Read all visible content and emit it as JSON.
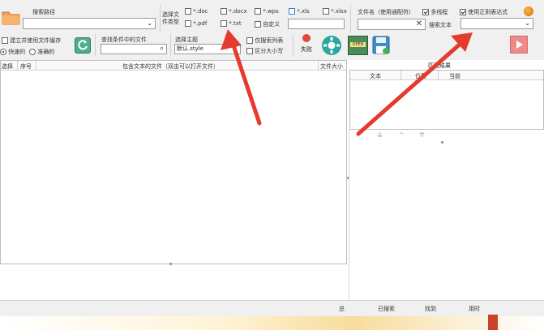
{
  "search_path": {
    "label": "搜索路径",
    "value": ""
  },
  "file_type": {
    "label": "选择文件类型",
    "options": [
      {
        "label": "*.doc",
        "checked": false,
        "blue": false
      },
      {
        "label": "*.docx",
        "checked": false,
        "blue": false
      },
      {
        "label": "*.wps",
        "checked": false,
        "blue": false
      },
      {
        "label": "*.xls",
        "checked": false,
        "blue": true
      },
      {
        "label": "*.xlsx",
        "checked": false,
        "blue": false
      },
      {
        "label": "*.pdf",
        "checked": false,
        "blue": false
      },
      {
        "label": "*.txt",
        "checked": false,
        "blue": false
      },
      {
        "label": "自定义",
        "checked": false,
        "blue": false
      }
    ],
    "custom_value": ""
  },
  "file_name": {
    "label": "文件名（使用通配符）",
    "value": ""
  },
  "multithread": {
    "label": "多线程",
    "checked": true
  },
  "regex": {
    "label": "使用正则表达式",
    "checked": true
  },
  "search_text": {
    "label": "搜索文本",
    "value": ""
  },
  "index": {
    "label": "建立并使用文件缓存",
    "checked": false
  },
  "mode": {
    "fast": "快速的",
    "accurate": "准确的",
    "selected": "fast"
  },
  "find_in_results": {
    "label": "查找条件中的文件",
    "value": ""
  },
  "theme": {
    "label": "选择主题",
    "value": "默认.style"
  },
  "search_in_results": {
    "label": "仅搜索列表",
    "checked": false
  },
  "match_case": {
    "label": "区分大小写",
    "checked": false
  },
  "fail_button": {
    "label": "失败"
  },
  "icons": {
    "folder": "folder-icon",
    "refresh": "refresh-icon",
    "gear": "gear-icon",
    "open": "open-icon",
    "save": "save-icon",
    "play": "play-icon"
  },
  "results_table": {
    "columns": [
      "选择",
      "序号",
      "包含文本的文件（双击可以打开文件）",
      "文件大小"
    ],
    "rows": []
  },
  "match_table": {
    "title": "匹配结果",
    "columns": [
      "文本",
      "位置",
      "当前"
    ],
    "rows": []
  },
  "open_button_label": "OPEN",
  "status_bar": {
    "total": "总",
    "searched": "已搜索",
    "found": "找到",
    "time": "用时"
  },
  "colors": {
    "accent": "#2d7fd3",
    "arrow": "#e53b2f",
    "panel": "#f0f0f0"
  }
}
